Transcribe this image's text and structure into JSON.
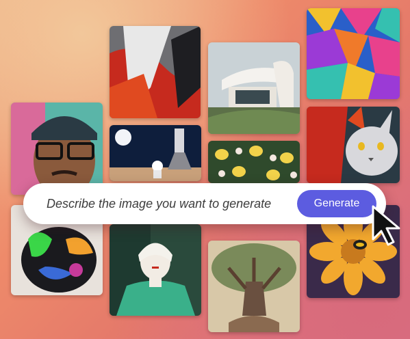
{
  "prompt": {
    "placeholder": "Describe the image you want to generate",
    "button_label": "Generate"
  },
  "colors": {
    "button": "#5c5ce0",
    "prompt_background": "#ffffff"
  },
  "tiles": [
    {
      "name": "tile-abstract-paint",
      "subject": "red and white abstract paint strokes"
    },
    {
      "name": "tile-modern-house",
      "subject": "modernist white house on hillside"
    },
    {
      "name": "tile-geometric-shapes",
      "subject": "colorful 3d geometric shapes"
    },
    {
      "name": "tile-man-glasses",
      "subject": "portrait of man with glasses and beanie"
    },
    {
      "name": "tile-astronaut-rocket",
      "subject": "astronaut and rocket on launch pad"
    },
    {
      "name": "tile-lemon-pattern",
      "subject": "lemons and flowers pattern"
    },
    {
      "name": "tile-red-cat",
      "subject": "cat with fiery red fur"
    },
    {
      "name": "tile-colorful-object",
      "subject": "glossy colorful sculpture"
    },
    {
      "name": "tile-woman-illustration",
      "subject": "illustrated woman in green top"
    },
    {
      "name": "tile-tree",
      "subject": "large old tree illustration"
    },
    {
      "name": "tile-flower-bee",
      "subject": "yellow flower with bee"
    }
  ]
}
